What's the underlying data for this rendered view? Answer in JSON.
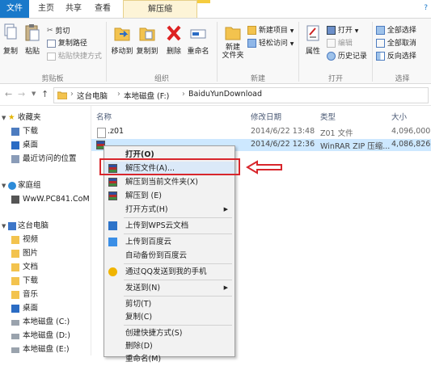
{
  "tabs": {
    "file": "文件",
    "home": "主页",
    "share": "共享",
    "view": "查看",
    "extract": "解压缩"
  },
  "ribbon": {
    "clipboard": {
      "copy": "复制",
      "paste": "粘贴",
      "cut": "剪切",
      "copy_path": "复制路径",
      "paste_shortcut": "粘贴快捷方式",
      "label": "剪贴板"
    },
    "organize": {
      "move_to": "移动到",
      "copy_to": "复制到",
      "delete": "删除",
      "rename": "重命名",
      "label": "组织"
    },
    "new": {
      "new_folder": "新建\n文件夹",
      "new_item": "新建项目",
      "easy_access": "轻松访问",
      "label": "新建"
    },
    "open": {
      "properties": "属性",
      "open": "打开",
      "edit": "编辑",
      "history": "历史记录",
      "label": "打开"
    },
    "select": {
      "select_all": "全部选择",
      "select_none": "全部取消",
      "invert": "反向选择",
      "label": "选择"
    }
  },
  "address": {
    "crumbs": [
      "这台电脑",
      "本地磁盘 (F:)",
      "BaiduYunDownload"
    ]
  },
  "nav": {
    "favorites": "收藏夹",
    "downloads": "下载",
    "desktop": "桌面",
    "recent": "最近访问的位置",
    "homegroup": "家庭组",
    "homegroup_user": "WwW.PC841.CoM",
    "this_pc": "这台电脑",
    "videos": "视频",
    "pictures": "图片",
    "documents": "文档",
    "pc_downloads": "下载",
    "music": "音乐",
    "pc_desktop": "桌面",
    "drive_c": "本地磁盘 (C:)",
    "drive_d": "本地磁盘 (D:)",
    "drive_e": "本地磁盘 (E:)"
  },
  "list": {
    "headers": {
      "name": "名称",
      "date": "修改日期",
      "type": "类型",
      "size": "大小"
    },
    "rows": [
      {
        "name": ".z01",
        "date": "2014/6/22 13:48",
        "type": "Z01 文件",
        "size": "4,096,000..."
      },
      {
        "name": "",
        "date": "2014/6/22 12:36",
        "type": "WinRAR ZIP 压缩...",
        "size": "4,086,826..."
      }
    ]
  },
  "menu": {
    "open": "打开(O)",
    "extract_files": "解压文件(A)...",
    "extract_here": "解压到当前文件夹(X)",
    "extract_to": "解压到 (E)",
    "open_with": "打开方式(H)",
    "upload_wps": "上传到WPS云文档",
    "upload_baidu": "上传到百度云",
    "auto_backup_baidu": "自动备份到百度云",
    "send_qq": "通过QQ发送到我的手机",
    "send_to": "发送到(N)",
    "cut": "剪切(T)",
    "copy": "复制(C)",
    "create_shortcut": "创建快捷方式(S)",
    "delete": "删除(D)",
    "rename": "重命名(M)"
  },
  "colors": {
    "accent": "#1979ca",
    "highlight": "#d8262c",
    "selection": "#cde8ff"
  }
}
